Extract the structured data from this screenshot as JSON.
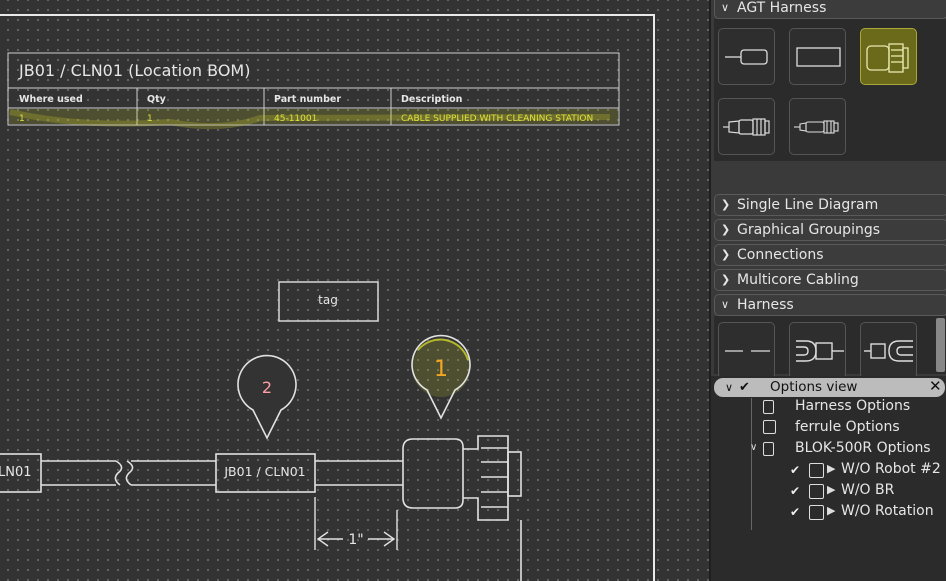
{
  "bom": {
    "title": "JB01 / CLN01 (Location BOM)",
    "columns": [
      "Where used",
      "Qty",
      "Part number",
      "Description"
    ],
    "rows": [
      [
        "1",
        "1",
        "45-11001",
        "CABLE SUPPLIED WITH CLEANING STATION"
      ]
    ]
  },
  "drawing": {
    "tag_label": "tag",
    "balloon_2": "2",
    "balloon_1": "1",
    "cable_label": "JB01 / CLN01",
    "left_label": "LN01",
    "dimension": "1\""
  },
  "panel": {
    "sections": {
      "agt_harness": "AGT Harness",
      "single_line": "Single Line Diagram",
      "graphical_groupings": "Graphical Groupings",
      "connections": "Connections",
      "multicore": "Multicore Cabling",
      "harness": "Harness"
    },
    "agt_tiles": [
      "ferrule-tile",
      "rectangle-tile",
      "connector-tile",
      "plug-tile",
      "small-plug-tile"
    ],
    "harness_tiles": [
      "splice-tile",
      "fork-terminal-tile",
      "ring-terminal-tile"
    ]
  },
  "options": {
    "header": "Options view",
    "items": [
      "Harness Options",
      "ferrule Options",
      "BLOK-500R Options"
    ],
    "sub_items": [
      "W/O Robot #2",
      "W/O BR",
      "W/O Rotation"
    ]
  },
  "colors": {
    "highlight": "#cfd12a",
    "balloon_1_text": "#f5a623",
    "balloon_2_text": "#ff9fa6",
    "line": "#e2e2e2"
  }
}
